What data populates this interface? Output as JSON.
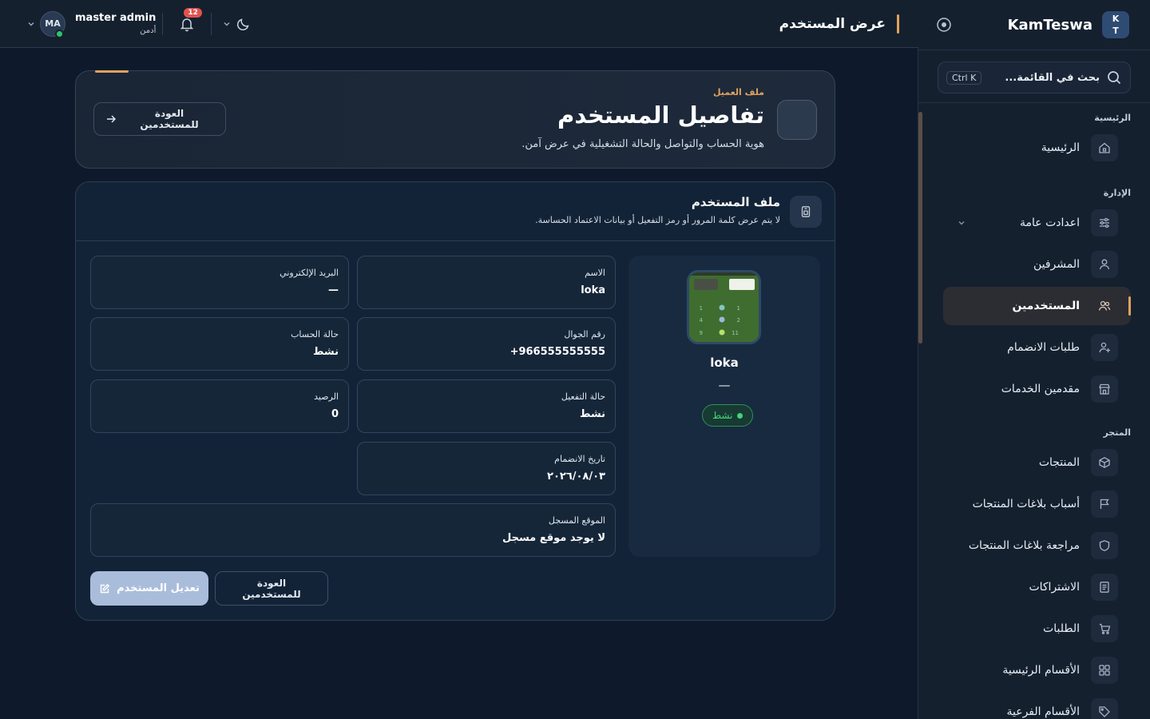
{
  "sidebar": {
    "brand_logo_line1": "K",
    "brand_logo_line2": "T",
    "brand_name": "KamTeswa",
    "search_placeholder": "بحث في القائمة...",
    "search_shortcut": "Ctrl K",
    "sections": {
      "home": "الرئيسية",
      "admin": "الإدارة",
      "store": "المتجر"
    },
    "items": [
      {
        "label": "الرئيسية",
        "icon": "home-icon"
      },
      {
        "label": "اعدادت عامة",
        "icon": "sliders-icon"
      },
      {
        "label": "المشرفين",
        "icon": "user-icon"
      },
      {
        "label": "المستخدمين",
        "icon": "users-icon"
      },
      {
        "label": "طلبات الانضمام",
        "icon": "user-plus-icon"
      },
      {
        "label": "مقدمين الخدمات",
        "icon": "store-icon"
      },
      {
        "label": "المنتجات",
        "icon": "box-icon"
      },
      {
        "label": "أسباب بلاغات المنتجات",
        "icon": "flag-icon"
      },
      {
        "label": "مراجعة بلاغات المنتجات",
        "icon": "shield-icon"
      },
      {
        "label": "الاشتراكات",
        "icon": "document-icon"
      },
      {
        "label": "الطلبات",
        "icon": "cart-icon"
      },
      {
        "label": "الأقسام الرئيسية",
        "icon": "grid-icon"
      },
      {
        "label": "الأقسام الفرعية",
        "icon": "tag-icon"
      }
    ]
  },
  "topbar": {
    "page_title": "عرض المستخدم",
    "notification_count": "12",
    "user_name": "master admin",
    "user_role": "أدمن",
    "avatar_initials": "MA"
  },
  "hero": {
    "eyebrow": "ملف العميل",
    "title": "تفاصيل المستخدم",
    "subtitle": "هوية الحساب والتواصل والحالة التشغيلية في عرض آمن.",
    "back_button": "العودة للمستخدمين"
  },
  "profile_card": {
    "title": "ملف المستخدم",
    "subtitle": "لا يتم عرض كلمة المرور أو رمز التفعيل أو بيانات الاعتماد الحساسة.",
    "name": "loka",
    "email_display": "—",
    "status": "نشط",
    "fields": {
      "name": {
        "label": "الاسم",
        "value": "loka"
      },
      "email": {
        "label": "البريد الإلكتروني",
        "value": "—"
      },
      "phone": {
        "label": "رقم الجوال",
        "value": "+966555555555"
      },
      "account_status": {
        "label": "حالة الحساب",
        "value": "نشط"
      },
      "activation_status": {
        "label": "حالة التفعيل",
        "value": "نشط"
      },
      "balance": {
        "label": "الرصيد",
        "value": "0"
      },
      "join_date": {
        "label": "تاريخ الانضمام",
        "value": "٢٠٢٦/٠٨/٠٣"
      },
      "location": {
        "label": "الموقع المسجل",
        "value": "لا يوجد موقع مسجل"
      }
    },
    "edit_button": "تعديل المستخدم",
    "back_button": "العودة للمستخدمين"
  },
  "colors": {
    "accent": "#e0a25e",
    "success": "#43d37b",
    "notification": "#e0534f",
    "primary_button": "#a9bddb"
  }
}
